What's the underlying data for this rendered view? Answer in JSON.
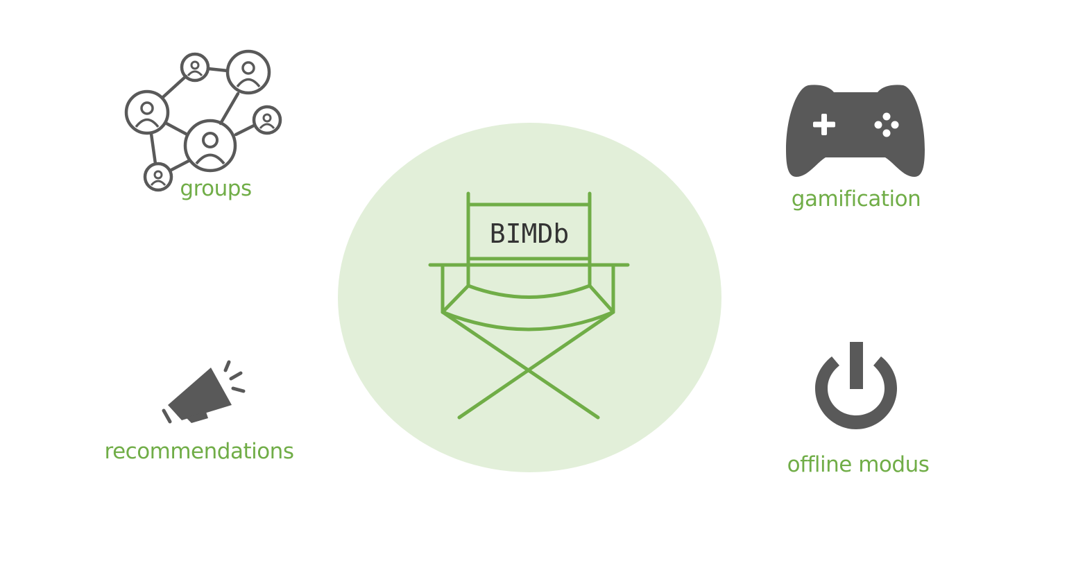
{
  "colors": {
    "accent": "#70ad47",
    "accent_light": "#e2efd9",
    "icon_gray": "#595959",
    "text_dark": "#333333",
    "background": "#ffffff"
  },
  "center": {
    "brand": "BIMDb",
    "icon": "directors-chair-icon"
  },
  "features": {
    "groups": {
      "label": "groups",
      "icon": "network-users-icon"
    },
    "gamification": {
      "label": "gamification",
      "icon": "gamepad-icon"
    },
    "recommendations": {
      "label": "recommendations",
      "icon": "megaphone-icon"
    },
    "offline": {
      "label": "offline modus",
      "icon": "power-icon"
    }
  }
}
